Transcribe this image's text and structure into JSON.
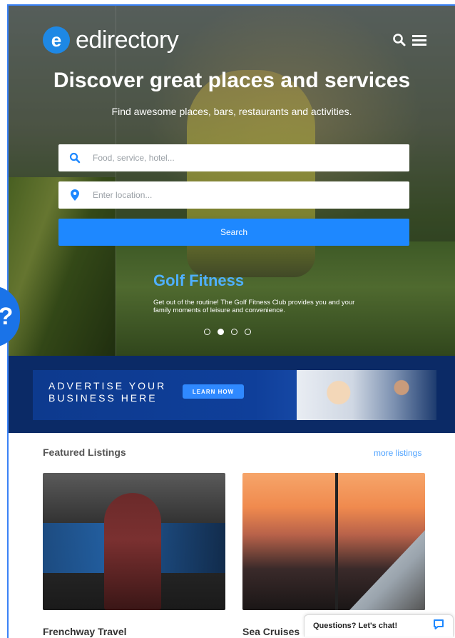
{
  "brand": {
    "name": "edirectory",
    "mark": "e",
    "color": "#1e88e5"
  },
  "header": {
    "search_icon": "search-icon",
    "menu_icon": "menu-icon"
  },
  "hero": {
    "title": "Discover great places and services",
    "subtitle": "Find awesome places, bars, restaurants and activities.",
    "keyword_placeholder": "Food, service, hotel...",
    "location_placeholder": "Enter location...",
    "search_label": "Search",
    "slide_title": "Golf Fitness",
    "slide_description": "Get out of the routine! The Golf Fitness Club provides you and your family moments of leisure and convenience.",
    "slides_total": 4,
    "slide_active": 2
  },
  "side_bubble": {
    "glyph": "?"
  },
  "ad": {
    "line1": "ADVERTISE YOUR",
    "line2": "BUSINESS HERE",
    "cta": "LEARN HOW"
  },
  "featured": {
    "title": "Featured Listings",
    "more": "more listings",
    "items": [
      {
        "title": "Frenchway Travel"
      },
      {
        "title": "Sea Cruises"
      }
    ]
  },
  "chat": {
    "label": "Questions? Let's chat!"
  },
  "colors": {
    "accent": "#1e88ff",
    "slide_title": "#4fb0ff",
    "ad_bg": "#0b2a66",
    "link": "#4fa3ff"
  }
}
